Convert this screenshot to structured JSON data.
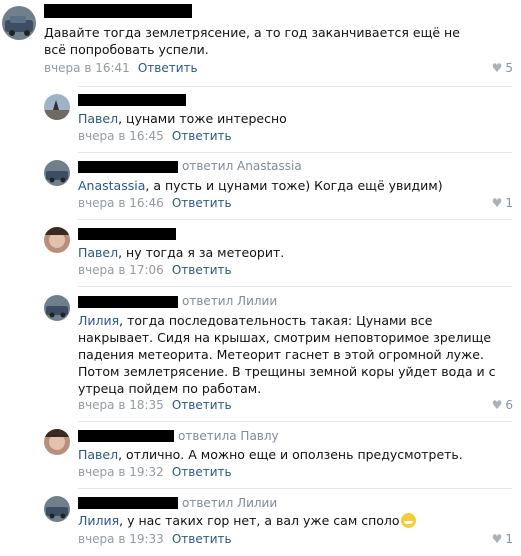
{
  "comments": [
    {
      "author_suffix": "",
      "text_plain": "Давайте тогда землетрясение, а то год заканчивается ещё не всё попробовать успели.",
      "mention": "",
      "time": "вчера в 16:41",
      "reply": "Ответить",
      "likes": "5"
    },
    {
      "author_suffix": "",
      "mention": "Павел",
      "text_plain": ", цунами тоже интересно",
      "time": "вчера в 16:45",
      "reply": "Ответить",
      "likes": ""
    },
    {
      "author_suffix": "ответил Anastassia",
      "mention": "Anastassia",
      "text_plain": ", а пусть и цунами тоже) Когда ещё увидим)",
      "time": "вчера в 16:46",
      "reply": "Ответить",
      "likes": "1"
    },
    {
      "author_suffix": "",
      "mention": "Павел",
      "text_plain": ", ну тогда я за метеорит.",
      "time": "вчера в 17:06",
      "reply": "Ответить",
      "likes": ""
    },
    {
      "author_suffix": "ответил Лилии",
      "mention": "Лилия",
      "text_plain": ", тогда последовательность такая: Цунами все накрывает. Сидя на крышах, смотрим неповторимое зрелище падения метеорита. Метеорит гаснет в этой огромной луже. Потом землетрясение. В трещины земной коры уйдет вода и с утреца пойдем по работам.",
      "time": "вчера в 18:35",
      "reply": "Ответить",
      "likes": "6"
    },
    {
      "author_suffix": "ответила Павлу",
      "mention": "Павел",
      "text_plain": ", отлично. А можно еще и оползень предусмотреть.",
      "time": "вчера в 19:32",
      "reply": "Ответить",
      "likes": ""
    },
    {
      "author_suffix": "ответил Лилии",
      "mention": "Лилия",
      "text_plain": ", у нас таких гор нет, а вал уже сам споло",
      "time": "вчера в 19:33",
      "reply": "Ответить",
      "likes": "1"
    }
  ],
  "icons": {
    "like": "heart-icon",
    "emoji": "grinning-face-emoji"
  },
  "colors": {
    "link": "#2a5885",
    "meta": "#939aa3"
  }
}
